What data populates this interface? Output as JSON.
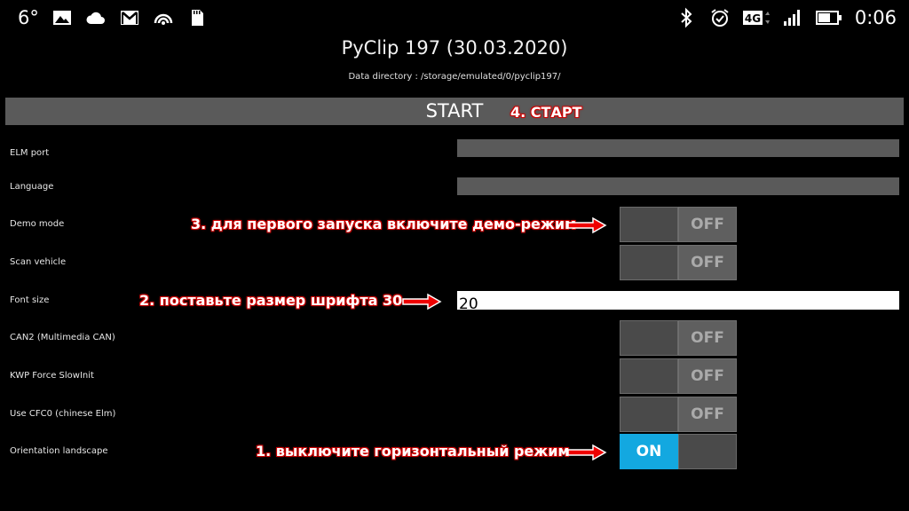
{
  "status_bar": {
    "temperature": "6°",
    "time": "0:06",
    "network_type": "4G",
    "left_icons": [
      "image-icon",
      "cloud-icon",
      "gmail-icon",
      "wifi-hotspot-icon",
      "sd-card-icon"
    ],
    "right_icons": [
      "bluetooth-icon",
      "alarm-icon",
      "network-4g-icon",
      "signal-icon",
      "battery-icon"
    ]
  },
  "header": {
    "title": "PyClip 197 (30.03.2020)",
    "data_directory": "Data directory : /storage/emulated/0/pyclip197/"
  },
  "start_button": {
    "label": "START"
  },
  "annotations": {
    "step4": "4. СТАРТ",
    "step3": "3. для первого запуска включите демо-режим",
    "step2": "2. поставьте размер шрифта 30",
    "step1": "1. выключите горизонтальный режим"
  },
  "settings": {
    "elm_port": {
      "label": "ELM port",
      "value": ""
    },
    "language": {
      "label": "Language",
      "value": ""
    },
    "demo_mode": {
      "label": "Demo mode",
      "state": "OFF"
    },
    "scan_vehicle": {
      "label": "Scan vehicle",
      "state": "OFF"
    },
    "font_size": {
      "label": "Font size",
      "value": "20"
    },
    "can2": {
      "label": "CAN2 (Multimedia CAN)",
      "state": "OFF"
    },
    "kwp_force": {
      "label": "KWP Force SlowInit",
      "state": "OFF"
    },
    "use_cfc0": {
      "label": "Use CFC0 (chinese Elm)",
      "state": "OFF"
    },
    "orientation": {
      "label": "Orientation landscape",
      "state": "ON"
    }
  },
  "colors": {
    "background": "#000000",
    "control_gray": "#5a5a5a",
    "toggle_on": "#13a8e0",
    "annotation_outline": "#cc0000"
  }
}
